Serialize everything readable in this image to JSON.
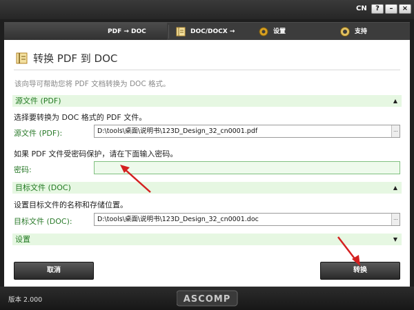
{
  "window": {
    "lang": "CN",
    "help": "?",
    "minimize": "–",
    "close": "×"
  },
  "tabs": [
    {
      "label": "PDF → DOC"
    },
    {
      "label": "DOC/DOCX → PDF"
    },
    {
      "label": "设置"
    },
    {
      "label": "支持"
    }
  ],
  "page": {
    "title": "转换 PDF 到 DOC",
    "intro": "该向导可帮助您将 PDF 文档转换为 DOC 格式。"
  },
  "source": {
    "section": "源文件 (PDF)",
    "description": "选择要转换为 DOC 格式的 PDF 文件。",
    "label": "源文件 (PDF):",
    "value": "D:\\tools\\桌面\\说明书\\123D_Design_32_cn0001.pdf",
    "browse": "..."
  },
  "password": {
    "description": "如果 PDF 文件受密码保护，请在下面输入密码。",
    "label": "密码:",
    "value": ""
  },
  "target": {
    "section": "目标文件 (DOC)",
    "description": "设置目标文件的名称和存储位置。",
    "label": "目标文件 (DOC):",
    "value": "D:\\tools\\桌面\\说明书\\123D_Design_32_cn0001.doc",
    "browse": "..."
  },
  "settings": {
    "section": "设置"
  },
  "buttons": {
    "cancel": "取消",
    "convert": "转换"
  },
  "footer": {
    "version": "版本 2.000",
    "logo": "ASCOMP"
  },
  "colors": {
    "accent_green": "#227a22",
    "section_bg": "#e6f7e2",
    "annotation_arrow": "#d42020"
  }
}
